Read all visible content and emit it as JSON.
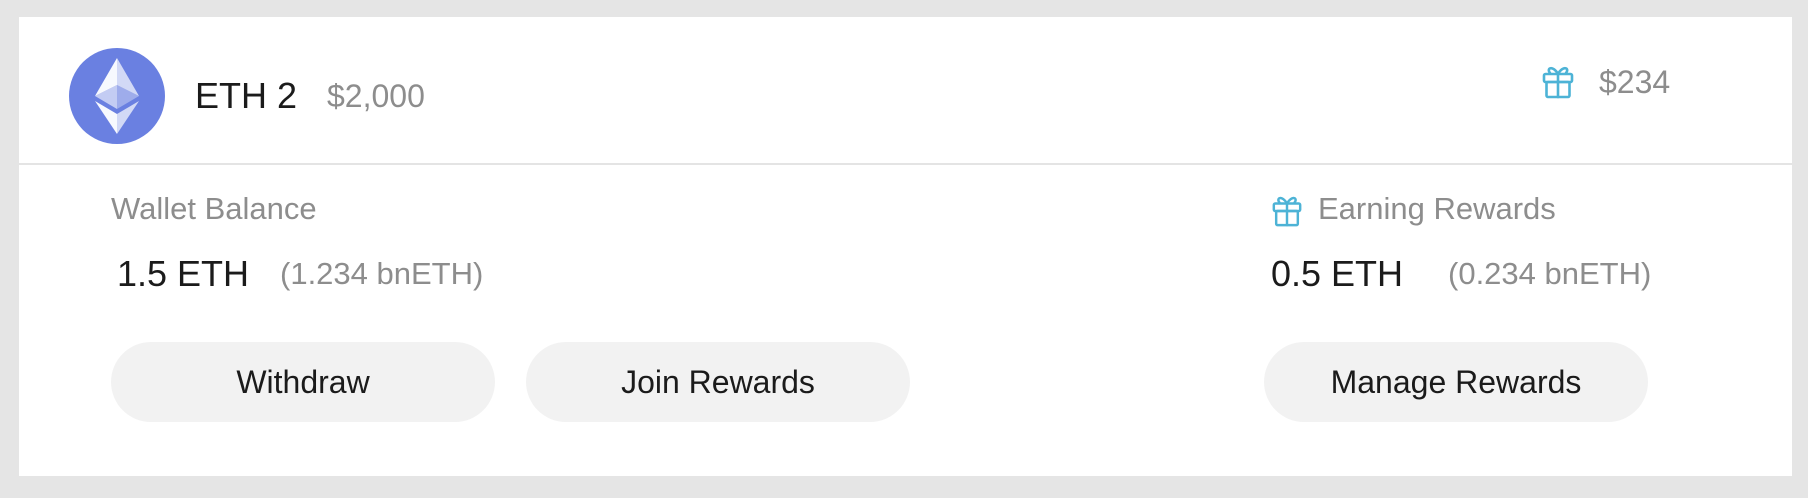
{
  "header": {
    "asset_name": "ETH 2",
    "asset_value": "$2,000",
    "rewards_value": "$234",
    "icons": {
      "logo": "ethereum-logo-icon",
      "rewards": "gift-icon"
    }
  },
  "wallet": {
    "label": "Wallet Balance",
    "amount": "1.5 ETH",
    "sub_amount": "(1.234 bnETH)"
  },
  "earning": {
    "label": "Earning Rewards",
    "amount": "0.5 ETH",
    "sub_amount": "(0.234 bnETH)",
    "icon": "gift-icon"
  },
  "buttons": {
    "withdraw": "Withdraw",
    "join_rewards": "Join Rewards",
    "manage_rewards": "Manage Rewards"
  },
  "colors": {
    "background": "#e5e5e5",
    "card": "#ffffff",
    "eth_logo": "#6a80e1",
    "gift_accent": "#4db3d6",
    "button_fill": "#f2f2f2",
    "muted_text": "#8d8d8d",
    "primary_text": "#1b1b1b"
  }
}
